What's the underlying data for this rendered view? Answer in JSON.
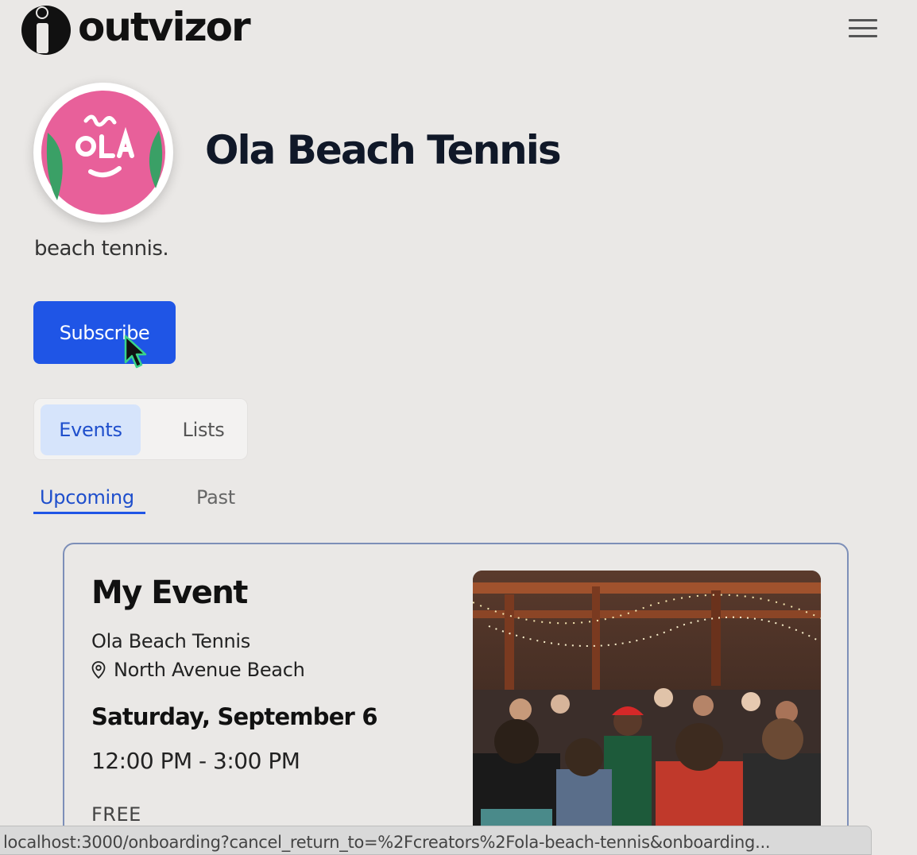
{
  "header": {
    "logo_text": "outvizor",
    "menu_icon": "hamburger-menu-icon"
  },
  "creator": {
    "name": "Ola Beach Tennis",
    "bio": "beach tennis.",
    "avatar_text": "OLA",
    "avatar_colors": {
      "ball": "#e8609a",
      "seam": "#3aa066"
    }
  },
  "actions": {
    "subscribe_label": "Subscribe",
    "accent": "#1f55e6"
  },
  "tabs": [
    {
      "label": "Events",
      "active": true
    },
    {
      "label": "Lists",
      "active": false
    }
  ],
  "subtabs": [
    {
      "label": "Upcoming",
      "active": true
    },
    {
      "label": "Past",
      "active": false
    }
  ],
  "events": [
    {
      "title": "My Event",
      "organizer": "Ola Beach Tennis",
      "location": "North Avenue Beach",
      "location_icon": "map-pin-icon",
      "date": "Saturday, September 6",
      "time": "12:00 PM - 3:00 PM",
      "price": "FREE",
      "image": "crowd-party-photo"
    }
  ],
  "status_bar": {
    "url": "localhost:3000/onboarding?cancel_return_to=%2Fcreators%2Fola-beach-tennis&onboarding..."
  }
}
